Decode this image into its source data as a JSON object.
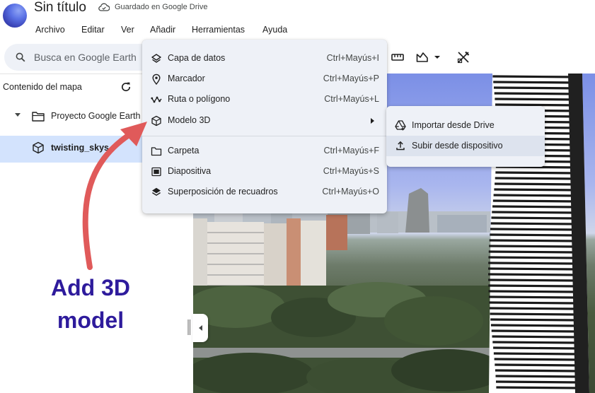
{
  "header": {
    "title": "Sin título",
    "save_status": "Guardado en Google Drive"
  },
  "menubar": [
    "Archivo",
    "Editar",
    "Ver",
    "Añadir",
    "Herramientas",
    "Ayuda"
  ],
  "search": {
    "placeholder": "Busca en Google Earth"
  },
  "sidebar": {
    "title": "Contenido del mapa",
    "project": "Proyecto Google Earth",
    "model": "twisting_skys"
  },
  "add_menu": {
    "items": [
      {
        "label": "Capa de datos",
        "shortcut": "Ctrl+Mayús+I",
        "icon": "layers-icon"
      },
      {
        "label": "Marcador",
        "shortcut": "Ctrl+Mayús+P",
        "icon": "pin-icon"
      },
      {
        "label": "Ruta o polígono",
        "shortcut": "Ctrl+Mayús+L",
        "icon": "path-icon"
      },
      {
        "label": "Modelo 3D",
        "shortcut": "",
        "icon": "cube-icon"
      },
      {
        "label": "Carpeta",
        "shortcut": "Ctrl+Mayús+F",
        "icon": "folder-icon"
      },
      {
        "label": "Diapositiva",
        "shortcut": "Ctrl+Mayús+S",
        "icon": "slide-icon"
      },
      {
        "label": "Superposición de recuadros",
        "shortcut": "Ctrl+Mayús+O",
        "icon": "overlay-icon"
      }
    ]
  },
  "model_submenu": {
    "items": [
      {
        "label": "Importar desde Drive",
        "icon": "drive-icon"
      },
      {
        "label": "Subir desde dispositivo",
        "icon": "upload-icon"
      }
    ]
  },
  "annotation": {
    "line1": "Add 3D",
    "line2": "model",
    "color": "#2e1b9c",
    "arrow_color": "#e05a5a"
  },
  "colors": {
    "selected_row": "#d3e3fd",
    "menu_bg": "#eef1f7"
  }
}
